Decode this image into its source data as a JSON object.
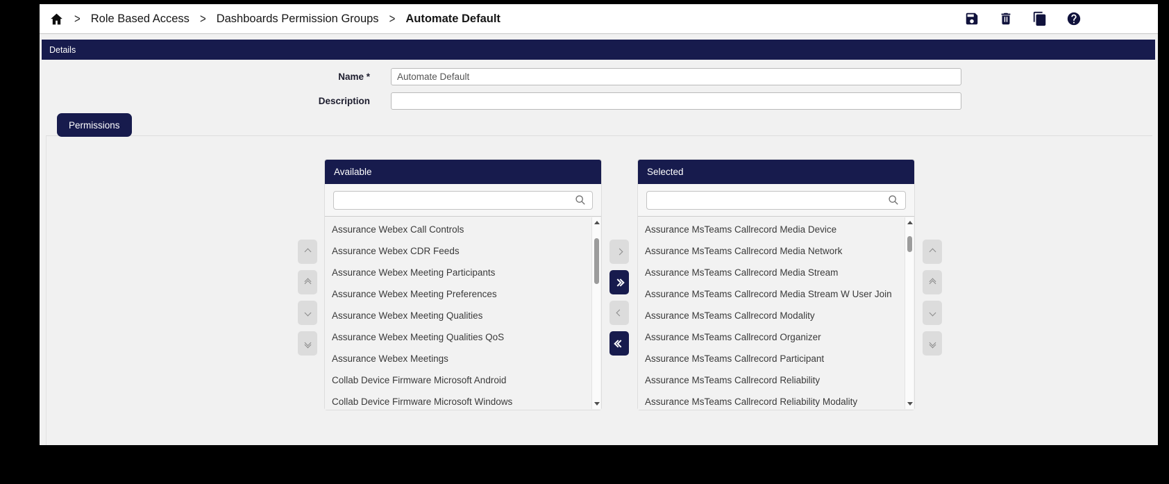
{
  "colors": {
    "navy": "#171b4d",
    "page_bg": "#f1f1f1",
    "topbar_bg": "#ffffff",
    "icon": "#10123c",
    "list_bg": "#f2f2f2",
    "button_gray": "#dcdcdc"
  },
  "breadcrumb": {
    "home_icon": "home-icon",
    "separator": ">",
    "items": [
      "Role Based Access",
      "Dashboards Permission Groups"
    ],
    "current": "Automate Default"
  },
  "toolbar": {
    "buttons": [
      {
        "name": "save",
        "icon": "save-icon"
      },
      {
        "name": "delete",
        "icon": "trash-icon"
      },
      {
        "name": "duplicate",
        "icon": "copy-icon"
      },
      {
        "name": "help",
        "icon": "help-icon"
      }
    ]
  },
  "details": {
    "header": "Details",
    "name_label": "Name *",
    "name_value": "Automate Default",
    "description_label": "Description",
    "description_value": ""
  },
  "tabs": {
    "permissions_label": "Permissions"
  },
  "transfer": {
    "available": {
      "header": "Available",
      "search_placeholder": "",
      "search_icon": "search-icon",
      "items": [
        "Assurance Webex Call Controls",
        "Assurance Webex CDR Feeds",
        "Assurance Webex Meeting Participants",
        "Assurance Webex Meeting Preferences",
        "Assurance Webex Meeting Qualities",
        "Assurance Webex Meeting Qualities QoS",
        "Assurance Webex Meetings",
        "Collab Device Firmware Microsoft Android",
        "Collab Device Firmware Microsoft Windows"
      ]
    },
    "selected": {
      "header": "Selected",
      "search_placeholder": "",
      "search_icon": "search-icon",
      "items": [
        "Assurance MsTeams Callrecord Media Device",
        "Assurance MsTeams Callrecord Media Network",
        "Assurance MsTeams Callrecord Media Stream",
        "Assurance MsTeams Callrecord Media Stream W User Join",
        "Assurance MsTeams Callrecord Modality",
        "Assurance MsTeams Callrecord Organizer",
        "Assurance MsTeams Callrecord Participant",
        "Assurance MsTeams Callrecord Reliability",
        "Assurance MsTeams Callrecord Reliability Modality"
      ]
    },
    "controls": {
      "move_right": "chevron-right-icon",
      "move_all_right": "double-chevron-right-icon",
      "move_left": "chevron-left-icon",
      "move_all_left": "double-chevron-left-icon",
      "move_up": "chevron-up-icon",
      "move_top": "double-chevron-up-icon",
      "move_down": "chevron-down-icon",
      "move_bottom": "double-chevron-down-icon"
    }
  }
}
